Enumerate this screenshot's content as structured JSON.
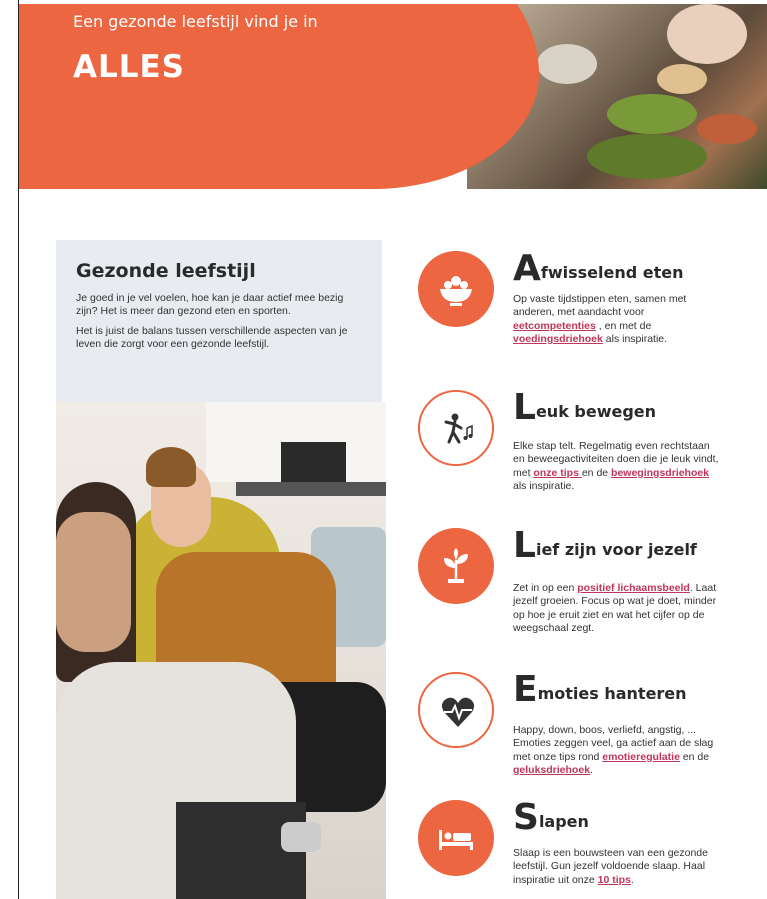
{
  "hero": {
    "subtitle": "Een gezonde leefstijl vind je in",
    "title": "ALLES"
  },
  "intro": {
    "heading": "Gezonde leefstijl",
    "paragraph1": "Je goed in je vel voelen, hoe kan je daar actief mee bezig zijn? Het is meer dan gezond eten en sporten.",
    "paragraph2": "Het is juist de balans tussen verschillende aspecten van je leven die zorgt voor een gezonde leefstijl."
  },
  "topics": [
    {
      "cap": "A",
      "rest": "fwisselend eten",
      "t1": "Op vaste tijdstippen eten, samen met anderen, met aandacht voor ",
      "l1": "eetcompetenties",
      "t2": " , en met de ",
      "l2": "voedingsdriehoek",
      "t3": " als inspiratie.",
      "icon": "fruit-bowl-icon"
    },
    {
      "cap": "L",
      "rest": "euk bewegen",
      "t1": "Elke stap telt. Regelmatig even rechtstaan en beweegactiviteiten doen die je leuk vindt, met ",
      "l1": "onze tips ",
      "t2": "en de ",
      "l2": "bewegingsdriehoek",
      "t3": " als inspiratie.",
      "icon": "dancing-person-icon"
    },
    {
      "cap": "L",
      "rest": "ief zijn voor jezelf",
      "t1": "Zet in op een ",
      "l1": "positief lichaamsbeeld",
      "t2": ". Laat jezelf groeien. Focus op wat je doet, minder op hoe je eruit ziet en wat het cijfer op de weegschaal zegt.",
      "l2": "",
      "t3": "",
      "icon": "plant-icon"
    },
    {
      "cap": "E",
      "rest": "moties hanteren",
      "t1": "Happy, down, boos, verliefd, angstig, ... Emoties zeggen veel, ga actief aan de slag met onze tips rond ",
      "l1": "emotieregulatie",
      "t2": " en de ",
      "l2": "geluksdriehoek",
      "t3": ".",
      "icon": "heart-pulse-icon"
    },
    {
      "cap": "S",
      "rest": "lapen",
      "t1": "Slaap is een bouwsteen van een gezonde leefstijl. Gun jezelf voldoende slaap. Haal inspiratie uit onze ",
      "l1": "10 tips",
      "t2": ".",
      "l2": "",
      "t3": "",
      "icon": "bed-icon"
    }
  ]
}
